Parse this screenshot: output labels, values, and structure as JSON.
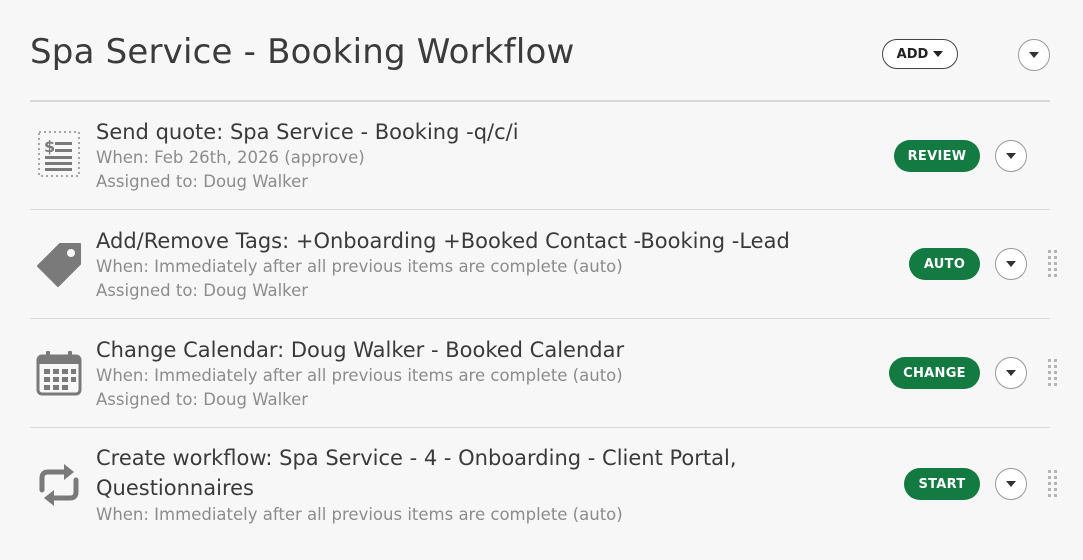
{
  "header": {
    "title": "Spa Service - Booking Workflow",
    "add_label": "ADD"
  },
  "items": [
    {
      "icon": "quote-document-icon",
      "title": "Send quote: Spa Service - Booking -q/c/i",
      "when": "When: Feb 26th, 2026 (approve)",
      "assigned": "Assigned to: Doug Walker",
      "action_label": "REVIEW"
    },
    {
      "icon": "tag-icon",
      "title": "Add/Remove Tags: +Onboarding +Booked Contact -Booking -Lead",
      "when": "When: Immediately after all previous items are complete (auto)",
      "assigned": "Assigned to: Doug Walker",
      "action_label": "AUTO"
    },
    {
      "icon": "calendar-icon",
      "title": "Change Calendar: Doug Walker - Booked Calendar",
      "when": "When: Immediately after all previous items are complete (auto)",
      "assigned": "Assigned to: Doug Walker",
      "action_label": "CHANGE"
    },
    {
      "icon": "workflow-repeat-icon",
      "title_line1": "Create workflow: Spa Service - 4 - Onboarding - Client Portal,",
      "title_line2": "Questionnaires",
      "when": "When: Immediately after all previous items are complete (auto)",
      "action_label": "START"
    }
  ],
  "colors": {
    "accent_green": "#137a42",
    "text_dark": "#3a3a3a",
    "text_muted": "#8c8c8c",
    "divider": "#d8d8d8"
  }
}
